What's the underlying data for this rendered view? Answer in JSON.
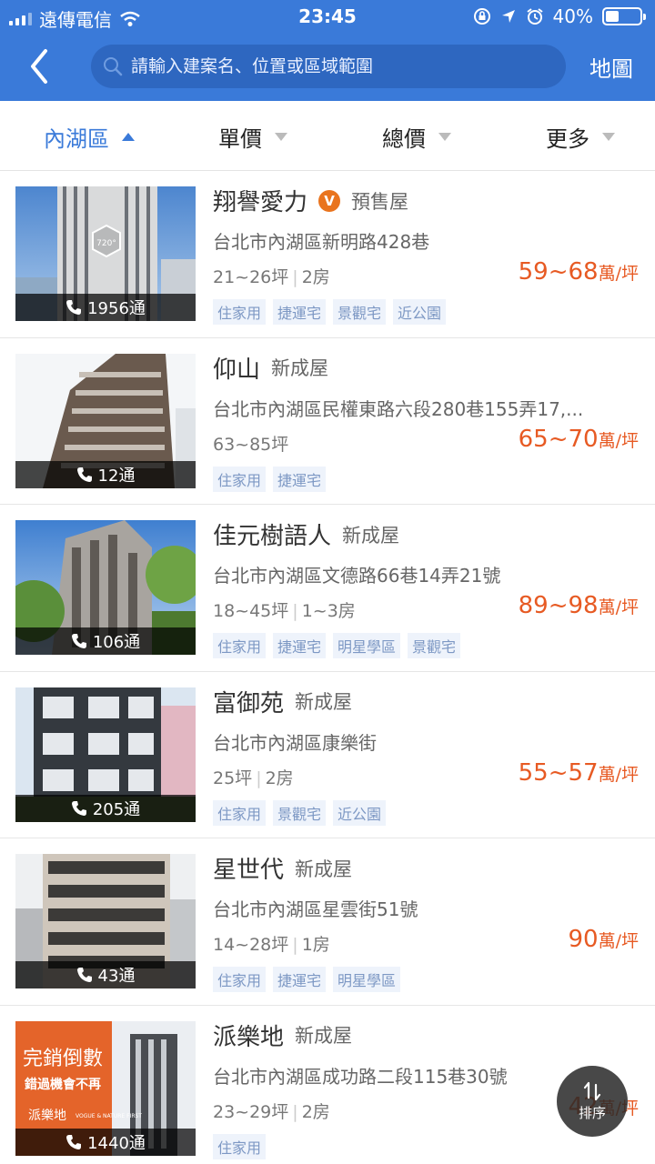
{
  "status_bar": {
    "carrier": "遠傳電信",
    "time": "23:45",
    "battery": "40%",
    "battery_level": 0.4
  },
  "nav": {
    "search_placeholder": "請輸入建案名、位置或區域範圍",
    "map_label": "地圖"
  },
  "filters": [
    {
      "label": "內湖區",
      "active": true
    },
    {
      "label": "單價",
      "active": false
    },
    {
      "label": "總價",
      "active": false
    },
    {
      "label": "更多",
      "active": false
    }
  ],
  "listings": [
    {
      "name": "翔譽愛力",
      "verified": "V",
      "type": "預售屋",
      "address": "台北市內湖區新明路428巷",
      "size": "21~26坪",
      "rooms": "2房",
      "price": "59~68",
      "unit": "萬/坪",
      "tags": [
        "住家用",
        "捷運宅",
        "景觀宅",
        "近公園"
      ],
      "calls": "1956通",
      "vr": "720°"
    },
    {
      "name": "仰山",
      "verified": "",
      "type": "新成屋",
      "address": "台北市內湖區民權東路六段280巷155弄17,...",
      "size": "63~85坪",
      "rooms": "",
      "price": "65~70",
      "unit": "萬/坪",
      "tags": [
        "住家用",
        "捷運宅"
      ],
      "calls": "12通"
    },
    {
      "name": "佳元樹語人",
      "verified": "",
      "type": "新成屋",
      "address": "台北市內湖區文德路66巷14弄21號",
      "size": "18~45坪",
      "rooms": "1~3房",
      "price": "89~98",
      "unit": "萬/坪",
      "tags": [
        "住家用",
        "捷運宅",
        "明星學區",
        "景觀宅"
      ],
      "calls": "106通"
    },
    {
      "name": "富御苑",
      "verified": "",
      "type": "新成屋",
      "address": "台北市內湖區康樂街",
      "size": "25坪",
      "rooms": "2房",
      "price": "55~57",
      "unit": "萬/坪",
      "tags": [
        "住家用",
        "景觀宅",
        "近公園"
      ],
      "calls": "205通"
    },
    {
      "name": "星世代",
      "verified": "",
      "type": "新成屋",
      "address": "台北市內湖區星雲街51號",
      "size": "14~28坪",
      "rooms": "1房",
      "price": "90",
      "unit": "萬/坪",
      "tags": [
        "住家用",
        "捷運宅",
        "明星學區"
      ],
      "calls": "43通"
    },
    {
      "name": "派樂地",
      "verified": "",
      "type": "新成屋",
      "address": "台北市內湖區成功路二段115巷30號",
      "size": "23~29坪",
      "rooms": "2房",
      "price": "42",
      "unit": "萬/坪",
      "tags": [
        "住家用"
      ],
      "calls": "1440通",
      "ad_text": "完銷倒數",
      "ad_sub": "錯過機會不再",
      "ad_brand": "派樂地",
      "ad_en": "VOGUE & NATURE FIRST"
    }
  ],
  "sort_button": {
    "label": "排序"
  },
  "colors": {
    "header": "#3a7ad9",
    "price": "#e75a23",
    "tag_bg": "#eef3fb",
    "tag_text": "#7d98c4"
  }
}
